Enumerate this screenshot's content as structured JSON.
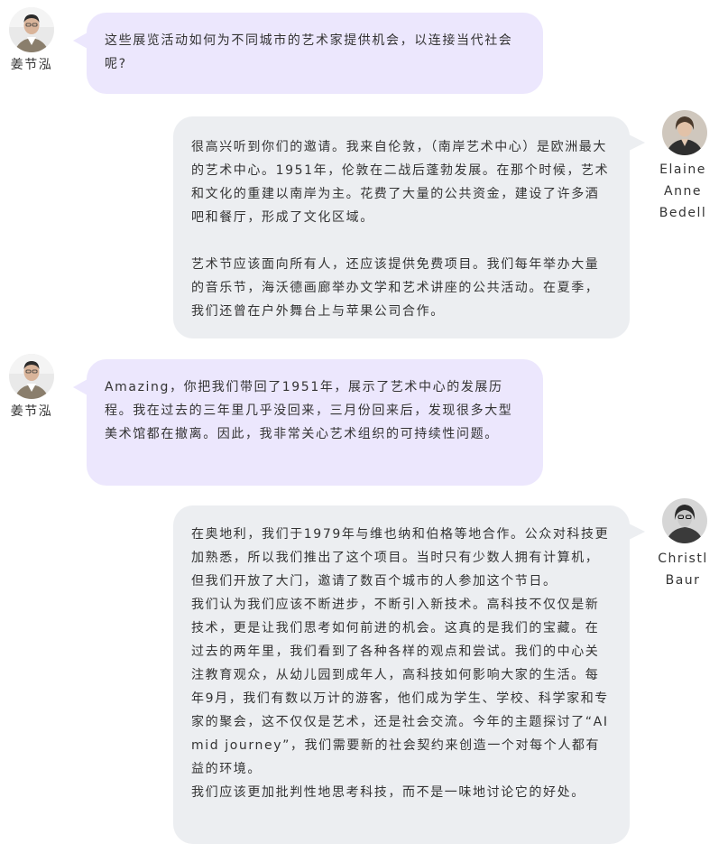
{
  "messages": [
    {
      "speaker": "姜节泓",
      "side": "left",
      "paragraphs": [
        "这些展览活动如何为不同城市的艺术家提供机会，以连接当代社会呢?"
      ]
    },
    {
      "speaker": "Elaine Anne Bedell",
      "speaker_lines": [
        "Elaine",
        "Anne",
        "Bedell"
      ],
      "side": "right",
      "paragraphs": [
        "很高兴听到你们的邀请。我来自伦敦，（南岸艺术中心）是欧洲最大的艺术中心。1951年，伦敦在二战后蓬勃发展。在那个时候，艺术和文化的重建以南岸为主。花费了大量的公共资金，建设了许多酒吧和餐厅，形成了文化区域。",
        "艺术节应该面向所有人，还应该提供免费项目。我们每年举办大量的音乐节，海沃德画廊举办文学和艺术讲座的公共活动。在夏季，我们还曾在户外舞台上与苹果公司合作。"
      ]
    },
    {
      "speaker": "姜节泓",
      "side": "left",
      "paragraphs": [
        "Amazing，你把我们带回了1951年，展示了艺术中心的发展历程。我在过去的三年里几乎没回来，三月份回来后，发现很多大型美术馆都在撤离。因此，我非常关心艺术组织的可持续性问题。"
      ]
    },
    {
      "speaker": "Christl Baur",
      "speaker_lines": [
        "Christl",
        "Baur"
      ],
      "side": "right",
      "paragraphs": [
        "在奥地利，我们于1979年与维也纳和伯格等地合作。公众对科技更加熟悉，所以我们推出了这个项目。当时只有少数人拥有计算机，但我们开放了大门，邀请了数百个城市的人参加这个节日。",
        "我们认为我们应该不断进步，不断引入新技术。高科技不仅仅是新技术，更是让我们思考如何前进的机会。这真的是我们的宝藏。在过去的两年里，我们看到了各种各样的观点和尝试。我们的中心关注教育观众，从幼儿园到成年人，高科技如何影响大家的生活。每年9月，我们有数以万计的游客，他们成为学生、学校、科学家和专家的聚会，这不仅仅是艺术，还是社会交流。今年的主题探讨了“AI mid journey”，我们需要新的社会契约来创造一个对每个人都有益的环境。",
        "我们应该更加批判性地思考科技，而不是一味地讨论它的好处。"
      ]
    }
  ],
  "colors": {
    "left_bubble": "#ece7fd",
    "right_bubble": "#eceef1",
    "text": "#333333"
  },
  "icons": [
    "avatar-jiang-jiehong",
    "avatar-elaine-anne-bedell",
    "avatar-christl-baur"
  ]
}
